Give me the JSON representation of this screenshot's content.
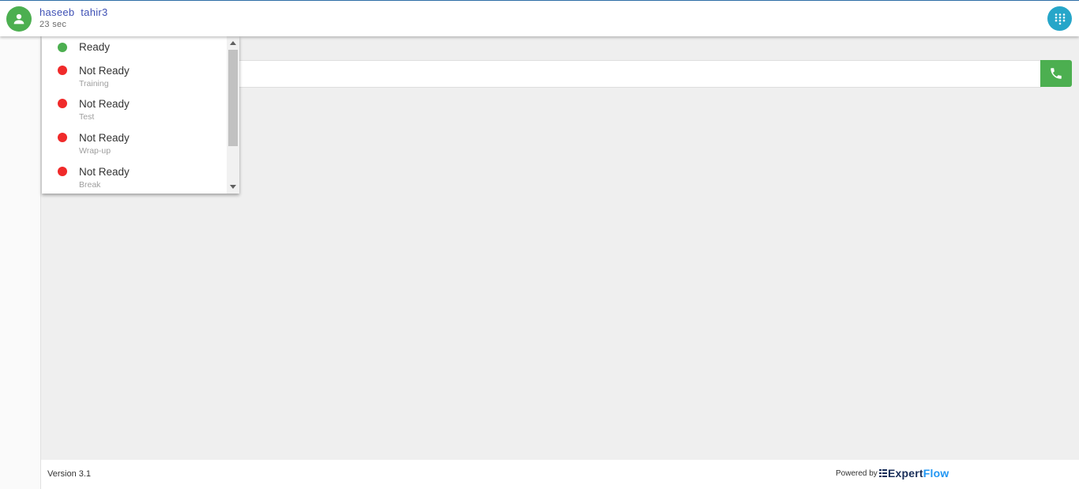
{
  "header": {
    "agent_name": "haseeb  tahir3",
    "timer": "23 sec",
    "avatar_icon": "person-icon",
    "dialpad_icon": "dialpad-icon"
  },
  "dialer": {
    "value": "",
    "placeholder": "",
    "call_icon": "phone-icon"
  },
  "state_menu": {
    "items": [
      {
        "label": "Ready",
        "reason": "",
        "status": "ready"
      },
      {
        "label": "Not Ready",
        "reason": "Training",
        "status": "not-ready"
      },
      {
        "label": "Not Ready",
        "reason": "Test",
        "status": "not-ready"
      },
      {
        "label": "Not Ready",
        "reason": "Wrap-up",
        "status": "not-ready"
      },
      {
        "label": "Not Ready",
        "reason": "Break",
        "status": "not-ready"
      }
    ]
  },
  "footer": {
    "version": "Version 3.1",
    "powered_by": "Powered by",
    "brand_part1": "Expert",
    "brand_part2": "Flow"
  },
  "colors": {
    "ready": "#4caf50",
    "not_ready": "#f02a2a",
    "agent_name": "#3f51b5",
    "dialpad": "#26a6c9",
    "call_button": "#4caf50"
  }
}
